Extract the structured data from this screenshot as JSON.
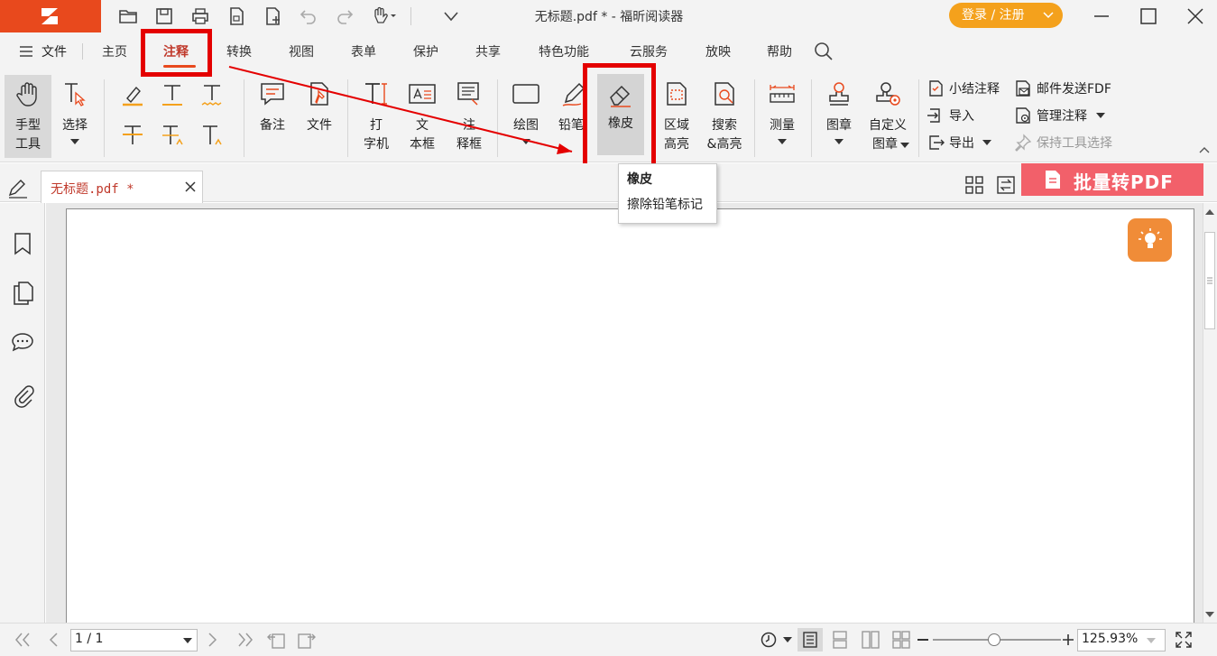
{
  "app": {
    "title": "无标题.pdf * - 福昕阅读器",
    "login_label": "登录 / 注册"
  },
  "menu": {
    "file": "文件",
    "items": [
      "主页",
      "注释",
      "转换",
      "视图",
      "表单",
      "保护",
      "共享",
      "特色功能",
      "云服务",
      "放映",
      "帮助"
    ],
    "active": "注释"
  },
  "ribbon": {
    "hand": [
      "手型",
      "工具"
    ],
    "select": "选择",
    "note": "备注",
    "file_attach": "文件",
    "typewriter": [
      "打",
      "字机"
    ],
    "textbox": [
      "文",
      "本框"
    ],
    "callout": [
      "注",
      "释框"
    ],
    "drawing": "绘图",
    "pencil": "铅笔",
    "eraser": "橡皮",
    "area_highlight": [
      "区域",
      "高亮"
    ],
    "search_highlight": [
      "搜索",
      "&高亮"
    ],
    "measure": "测量",
    "stamp": "图章",
    "custom_stamp": [
      "自定义",
      "图章"
    ],
    "summarize": "小结注释",
    "import": "导入",
    "export": "导出",
    "email_fdf": "邮件发送FDF",
    "manage": "管理注释",
    "keep_tool": "保持工具选择"
  },
  "tooltip": {
    "title": "橡皮",
    "desc": "擦除铅笔标记"
  },
  "tab": {
    "doc_name": "无标题.pdf *",
    "batch_label": "批量转PDF"
  },
  "status": {
    "page": "1 / 1",
    "zoom": "125.93%",
    "zoom_level": 0.48
  },
  "colors": {
    "brand": "#e8491d",
    "login": "#f4a11c",
    "highlight_box": "#e40000",
    "batch": "#f2606a",
    "bulb": "#f08c38"
  },
  "icons": [
    "folder-open-icon",
    "save-icon",
    "print-icon",
    "new-doc-icon",
    "undo-icon",
    "redo-icon",
    "hand-icon",
    "eraser-icon",
    "lightbulb-icon",
    "search-icon"
  ]
}
